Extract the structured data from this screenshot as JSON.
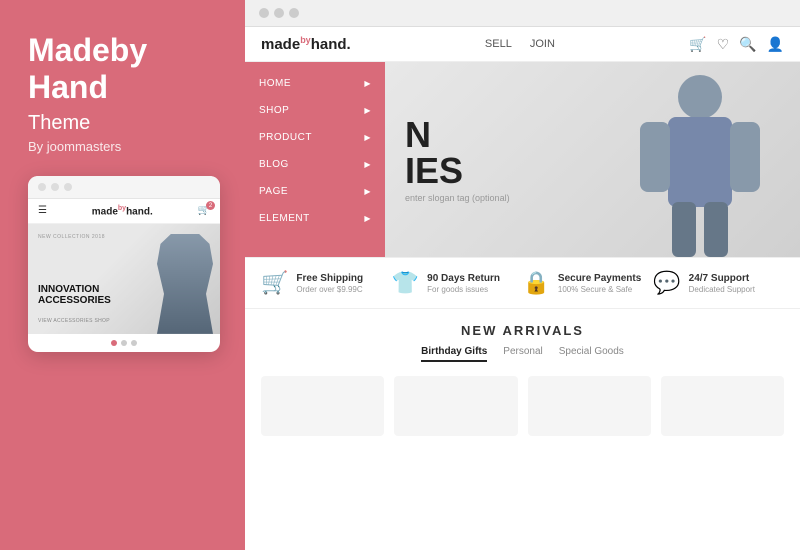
{
  "left": {
    "title": "Madeby Hand",
    "subtitle": "Theme",
    "by": "By joommasters",
    "mini_browser": {
      "logo": "made",
      "logo_super": "by",
      "logo_end": "hand.",
      "collection_label": "NEW COLLECTION 2018",
      "headline_line1": "INNOVATION",
      "headline_line2": "ACCESSORIES",
      "cta": "VIEW ACCESSORIES SHOP",
      "dots": [
        "active",
        "",
        ""
      ]
    }
  },
  "browser": {
    "dots": [
      "dot1",
      "dot2",
      "dot3"
    ]
  },
  "site": {
    "logo_pre": "made",
    "logo_super": "by",
    "logo_end": "hand.",
    "nav": [
      {
        "label": "SELL"
      },
      {
        "label": "JOIN"
      }
    ],
    "icons": [
      "cart",
      "heart",
      "search",
      "user"
    ]
  },
  "nav_menu": {
    "items": [
      {
        "label": "HOME"
      },
      {
        "label": "SHOP"
      },
      {
        "label": "PRODUCT"
      },
      {
        "label": "BLOG"
      },
      {
        "label": "PAGE"
      },
      {
        "label": "ELEMENT"
      }
    ]
  },
  "hero": {
    "headline_line1": "N",
    "headline_line2": "IES",
    "sub": "enter slogan tag (optional)"
  },
  "features": [
    {
      "icon": "🛒",
      "title": "Free Shipping",
      "desc": "Order over $9.99C"
    },
    {
      "icon": "👕",
      "title": "90 Days Return",
      "desc": "For goods issues"
    },
    {
      "icon": "🔒",
      "title": "Secure Payments",
      "desc": "100% Secure & Safe"
    },
    {
      "icon": "💬",
      "title": "24/7 Support",
      "desc": "Dedicated Support"
    }
  ],
  "arrivals": {
    "title": "NEW ARRIVALS",
    "tabs": [
      {
        "label": "Birthday Gifts",
        "active": true
      },
      {
        "label": "Personal",
        "active": false
      },
      {
        "label": "Special Goods",
        "active": false
      }
    ]
  }
}
